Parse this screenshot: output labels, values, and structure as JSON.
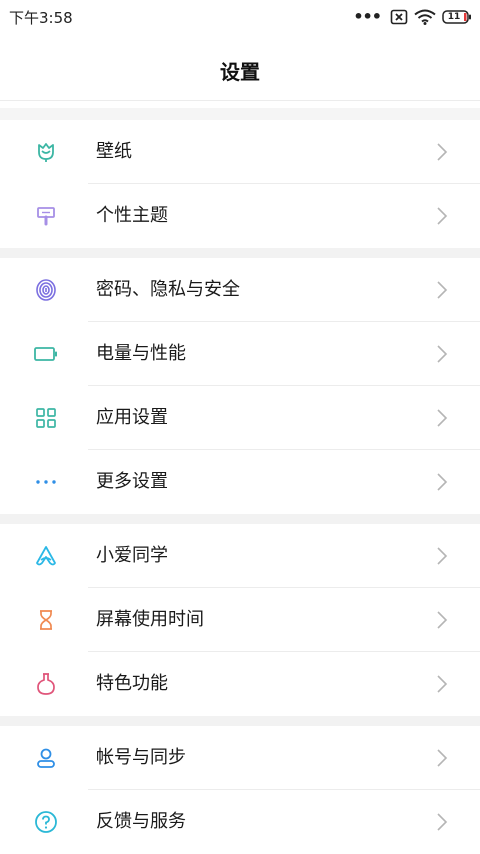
{
  "status_bar": {
    "time": "下午3:58",
    "battery_level": "11",
    "icons": [
      "more-dots-icon",
      "sim-x-icon",
      "wifi-icon",
      "battery-icon"
    ]
  },
  "header": {
    "title": "设置"
  },
  "colors": {
    "wallpaper": "#3cb6a4",
    "theme": "#a68fe6",
    "privacy": "#7b6fe0",
    "battery": "#3cb6a4",
    "apps": "#3cb6a4",
    "more": "#2f8fe6",
    "xiaoai": "#2bb8e6",
    "screen_time": "#f08a52",
    "special": "#e0557a",
    "account": "#2f8fe6",
    "feedback": "#2bb8d6",
    "chevron": "#b5b5b5"
  },
  "groups": [
    {
      "items": [
        {
          "label": "壁纸",
          "icon": "tulip-icon"
        },
        {
          "label": "个性主题",
          "icon": "paint-brush-icon"
        }
      ]
    },
    {
      "items": [
        {
          "label": "密码、隐私与安全",
          "icon": "fingerprint-icon"
        },
        {
          "label": "电量与性能",
          "icon": "battery-outline-icon"
        },
        {
          "label": "应用设置",
          "icon": "grid-icon"
        },
        {
          "label": "更多设置",
          "icon": "ellipsis-icon"
        }
      ]
    },
    {
      "items": [
        {
          "label": "小爱同学",
          "icon": "xiaoai-icon"
        },
        {
          "label": "屏幕使用时间",
          "icon": "hourglass-icon"
        },
        {
          "label": "特色功能",
          "icon": "flask-icon"
        }
      ]
    },
    {
      "items": [
        {
          "label": "帐号与同步",
          "icon": "person-icon"
        },
        {
          "label": "反馈与服务",
          "icon": "question-circle-icon"
        }
      ]
    }
  ]
}
